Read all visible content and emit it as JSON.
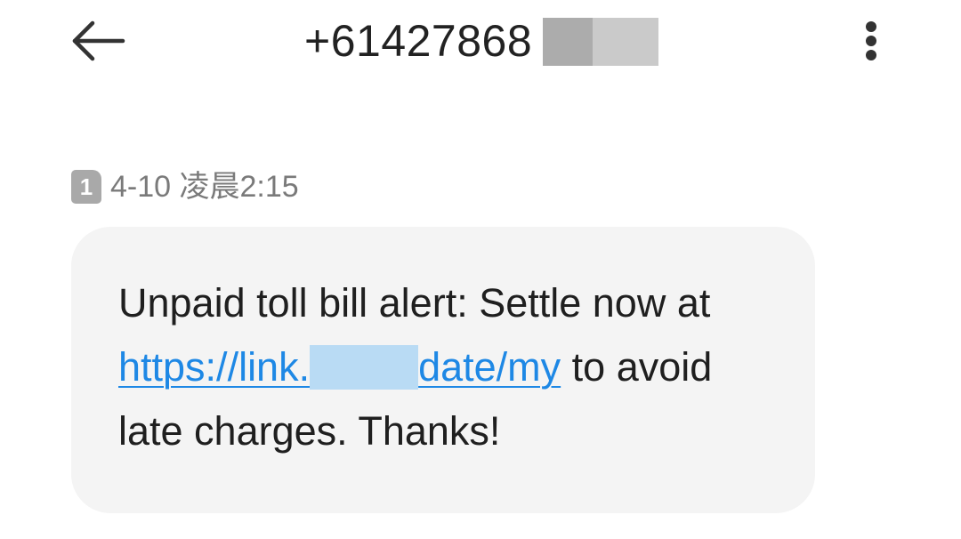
{
  "header": {
    "back_icon": "arrow-left-icon",
    "title": "+61427868",
    "more_icon": "more-vertical-icon"
  },
  "message": {
    "sim_label": "1",
    "timestamp": "4-10 凌晨2:15",
    "line1": "Unpaid toll bill alert: Settle now at",
    "link_start": "https://link.",
    "link_end": "date/my",
    "line2_rest": " to avoid",
    "line3": "late charges. Thanks!"
  },
  "colors": {
    "link": "#1e88e5",
    "bubble": "#f4f4f4",
    "timestamp": "#7a7a7a"
  }
}
